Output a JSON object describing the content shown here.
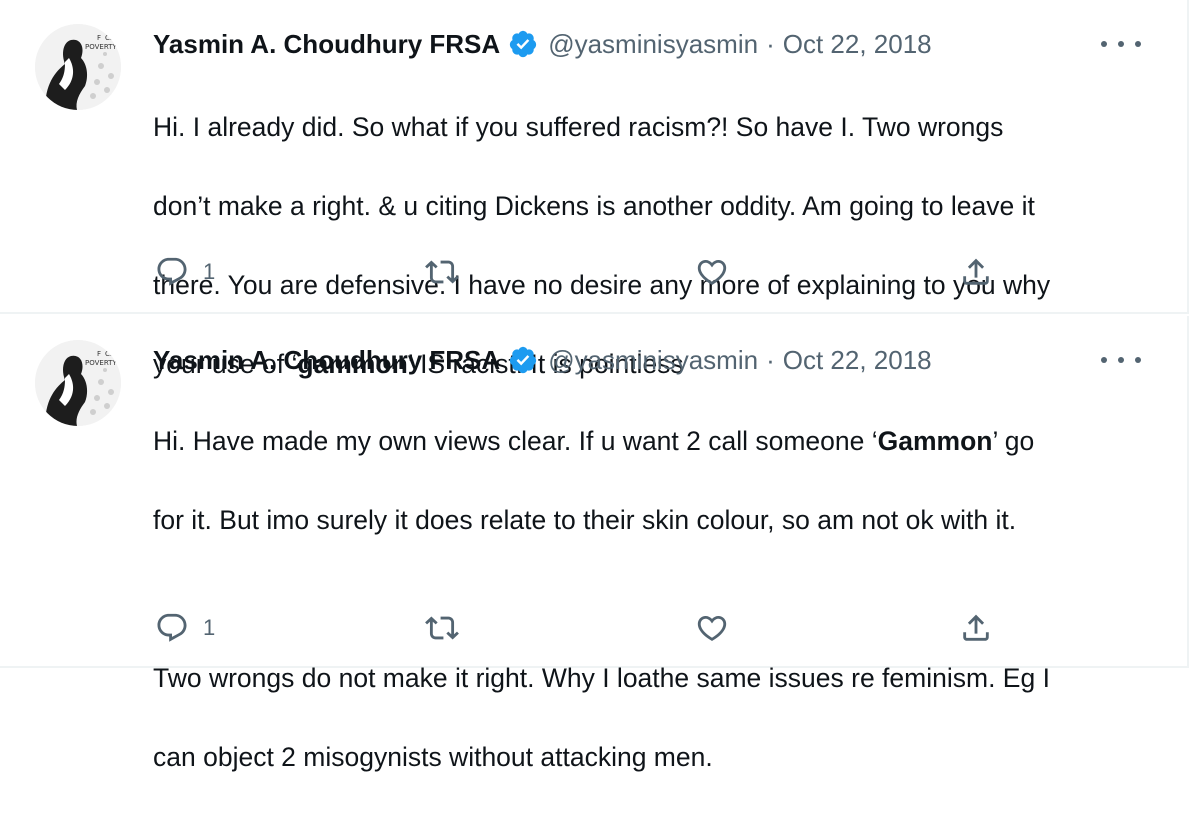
{
  "tweets": [
    {
      "author_name": "Yasmin A. Choudhury FRSA",
      "handle": "@yasminisyasmin",
      "separator": "·",
      "date": "Oct 22, 2018",
      "avatar_text_1": "F",
      "avatar_text_2": "CK",
      "avatar_text_3": "POVERTY",
      "lines": [
        {
          "pre": "Hi. I already did. So what if you suffered racism?! So have I. Two wrongs",
          "bold": "",
          "post": ""
        },
        {
          "pre": "don’t make a right. & u citing Dickens is another oddity. Am going to leave it",
          "bold": "",
          "post": ""
        },
        {
          "pre": "there. You are defensive. I have no desire any more of explaining to you why",
          "bold": "",
          "post": ""
        },
        {
          "pre": "your use of  ‘",
          "bold": "gammon",
          "post": "’ IS racist. It is pointless"
        }
      ],
      "reply_count": "1",
      "icons": {
        "reply": "reply-icon",
        "retweet": "retweet-icon",
        "like": "heart-icon",
        "share": "share-icon",
        "verified": "verified-badge-icon",
        "more": "more-icon"
      }
    },
    {
      "author_name": "Yasmin A. Choudhury FRSA",
      "handle": "@yasminisyasmin",
      "separator": "·",
      "date": "Oct 22, 2018",
      "avatar_text_1": "F",
      "avatar_text_2": "CK",
      "avatar_text_3": "POVERTY",
      "lines": [
        {
          "pre": "Hi. Have made my own views clear. If u want 2 call someone ‘",
          "bold": "Gammon",
          "post": "’ go"
        },
        {
          "pre": "for it. But imo surely it does relate to their skin colour,  so am not ok with it.",
          "bold": "",
          "post": ""
        },
        {
          "pre": "",
          "bold": "",
          "post": ""
        },
        {
          "pre": "Two wrongs do not make it right. Why I loathe same issues re feminism. Eg I",
          "bold": "",
          "post": ""
        },
        {
          "pre": "can object 2 misogynists without attacking men.",
          "bold": "",
          "post": ""
        }
      ],
      "reply_count": "1",
      "icons": {
        "reply": "reply-icon",
        "retweet": "retweet-icon",
        "like": "heart-icon",
        "share": "share-icon",
        "verified": "verified-badge-icon",
        "more": "more-icon"
      }
    }
  ],
  "colors": {
    "verified_blue": "#1d9bf0",
    "secondary_text": "#536471",
    "divider": "#eff3f4"
  }
}
